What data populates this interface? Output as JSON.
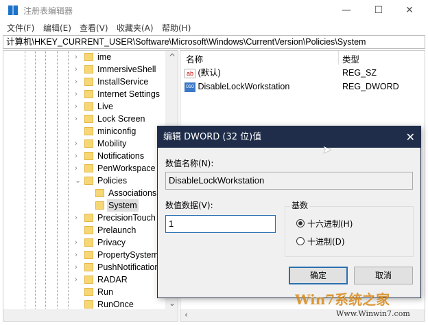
{
  "window": {
    "title": "注册表编辑器",
    "minimize": "—",
    "maximize": "☐",
    "close": "✕"
  },
  "menu": [
    "文件(F)",
    "编辑(E)",
    "查看(V)",
    "收藏夹(A)",
    "帮助(H)"
  ],
  "address": "计算机\\HKEY_CURRENT_USER\\Software\\Microsoft\\Windows\\CurrentVersion\\Policies\\System",
  "tree": [
    {
      "label": "ime",
      "level": 0,
      "chev": "›"
    },
    {
      "label": "ImmersiveShell",
      "level": 0,
      "chev": "›"
    },
    {
      "label": "InstallService",
      "level": 0,
      "chev": "›"
    },
    {
      "label": "Internet Settings",
      "level": 0,
      "chev": "›"
    },
    {
      "label": "Live",
      "level": 0,
      "chev": "›"
    },
    {
      "label": "Lock Screen",
      "level": 0,
      "chev": "›"
    },
    {
      "label": "miniconfig",
      "level": 0,
      "chev": ""
    },
    {
      "label": "Mobility",
      "level": 0,
      "chev": "›"
    },
    {
      "label": "Notifications",
      "level": 0,
      "chev": "›"
    },
    {
      "label": "PenWorkspace",
      "level": 0,
      "chev": "›"
    },
    {
      "label": "Policies",
      "level": 0,
      "chev": "⌄"
    },
    {
      "label": "Associations",
      "level": 1,
      "chev": ""
    },
    {
      "label": "System",
      "level": 1,
      "chev": "",
      "selected": true
    },
    {
      "label": "PrecisionTouch",
      "level": 0,
      "chev": "›"
    },
    {
      "label": "Prelaunch",
      "level": 0,
      "chev": ""
    },
    {
      "label": "Privacy",
      "level": 0,
      "chev": "›"
    },
    {
      "label": "PropertySystem",
      "level": 0,
      "chev": "›"
    },
    {
      "label": "PushNotification",
      "level": 0,
      "chev": "›"
    },
    {
      "label": "RADAR",
      "level": 0,
      "chev": "›"
    },
    {
      "label": "Run",
      "level": 0,
      "chev": ""
    },
    {
      "label": "RunOnce",
      "level": 0,
      "chev": ""
    }
  ],
  "list": {
    "headers": {
      "name": "名称",
      "type": "类型"
    },
    "rows": [
      {
        "name": "(默认)",
        "type": "REG_SZ",
        "icon": "ab"
      },
      {
        "name": "DisableLockWorkstation",
        "type": "REG_DWORD",
        "icon": "010"
      }
    ]
  },
  "dialog": {
    "title": "编辑 DWORD (32 位)值",
    "name_label": "数值名称(N):",
    "name_value": "DisableLockWorkstation",
    "data_label": "数值数据(V):",
    "data_value": "1",
    "base_label": "基数",
    "hex": "十六进制(H)",
    "dec": "十进制(D)",
    "ok": "确定",
    "cancel": "取消",
    "close": "✕"
  },
  "watermark": {
    "brand": "Win7系统之家",
    "url": "Www.Winwin7.com"
  }
}
